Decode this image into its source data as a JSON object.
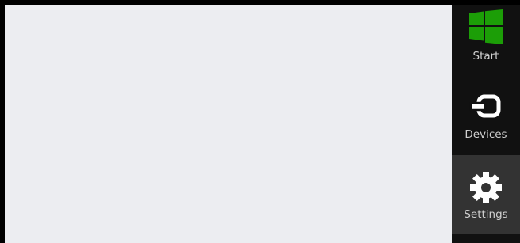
{
  "charms": {
    "items": [
      {
        "id": "start",
        "label": "Start",
        "icon": "windows-logo-icon",
        "selected": false
      },
      {
        "id": "devices",
        "label": "Devices",
        "icon": "devices-icon",
        "selected": false
      },
      {
        "id": "settings",
        "label": "Settings",
        "icon": "gear-icon",
        "selected": true
      }
    ]
  },
  "colors": {
    "content_background": "#ecedf1",
    "charms_background": "#111111",
    "selected_background": "#333333",
    "windows_logo": "#1c9e07",
    "label_text": "#d0d0d0"
  }
}
